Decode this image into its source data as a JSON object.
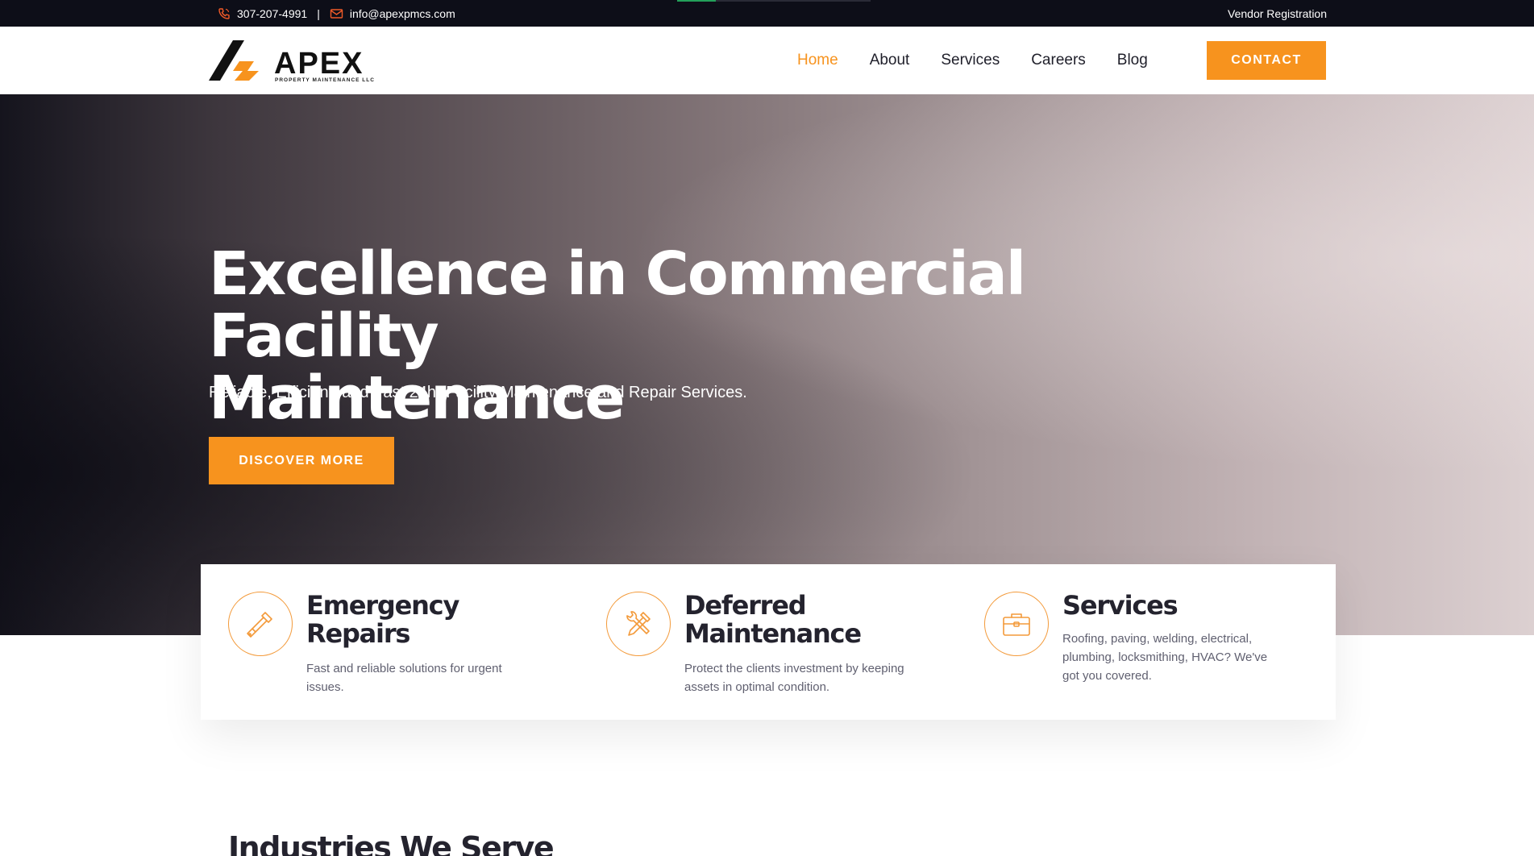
{
  "topbar": {
    "phone": "307-207-4991",
    "separator": "|",
    "email": "info@apexpmcs.com",
    "vendor_link": "Vendor Registration"
  },
  "header": {
    "logo_word": "APEX",
    "logo_sub": "PROPERTY MAINTENANCE LLC",
    "nav": [
      "Home",
      "About",
      "Services",
      "Careers",
      "Blog"
    ],
    "active_nav": "Home",
    "contact_label": "CONTACT"
  },
  "hero": {
    "title_line1": "Excellence in Commercial Facility",
    "title_line2": "Maintenance",
    "tagline": "Reliable, Efficient, and Fast 24hr Facility Maintenance and Repair Services.",
    "cta_label": "DISCOVER MORE"
  },
  "features": [
    {
      "title_line1": "Emergency",
      "title_line2": "Repairs",
      "desc_line1": "Fast and reliable solutions for urgent",
      "desc_line2": "issues.",
      "icon": "screwdriver-icon"
    },
    {
      "title_line1": "Deferred",
      "title_line2": "Maintenance",
      "desc_line1": "Protect the clients investment by keeping",
      "desc_line2": "assets in optimal condition.",
      "icon": "tools-icon"
    },
    {
      "title_line1": "Services",
      "desc_line1": "Roofing, paving, welding, electrical,",
      "desc_line2": "plumbing, locksmithing, HVAC? We've",
      "desc_line3": "got you covered.",
      "icon": "briefcase-icon"
    }
  ],
  "industries_heading": "Industries We Serve",
  "colors": {
    "accent": "#f7931e",
    "topbar_bg": "#0d0e18",
    "heading": "#24232e"
  }
}
